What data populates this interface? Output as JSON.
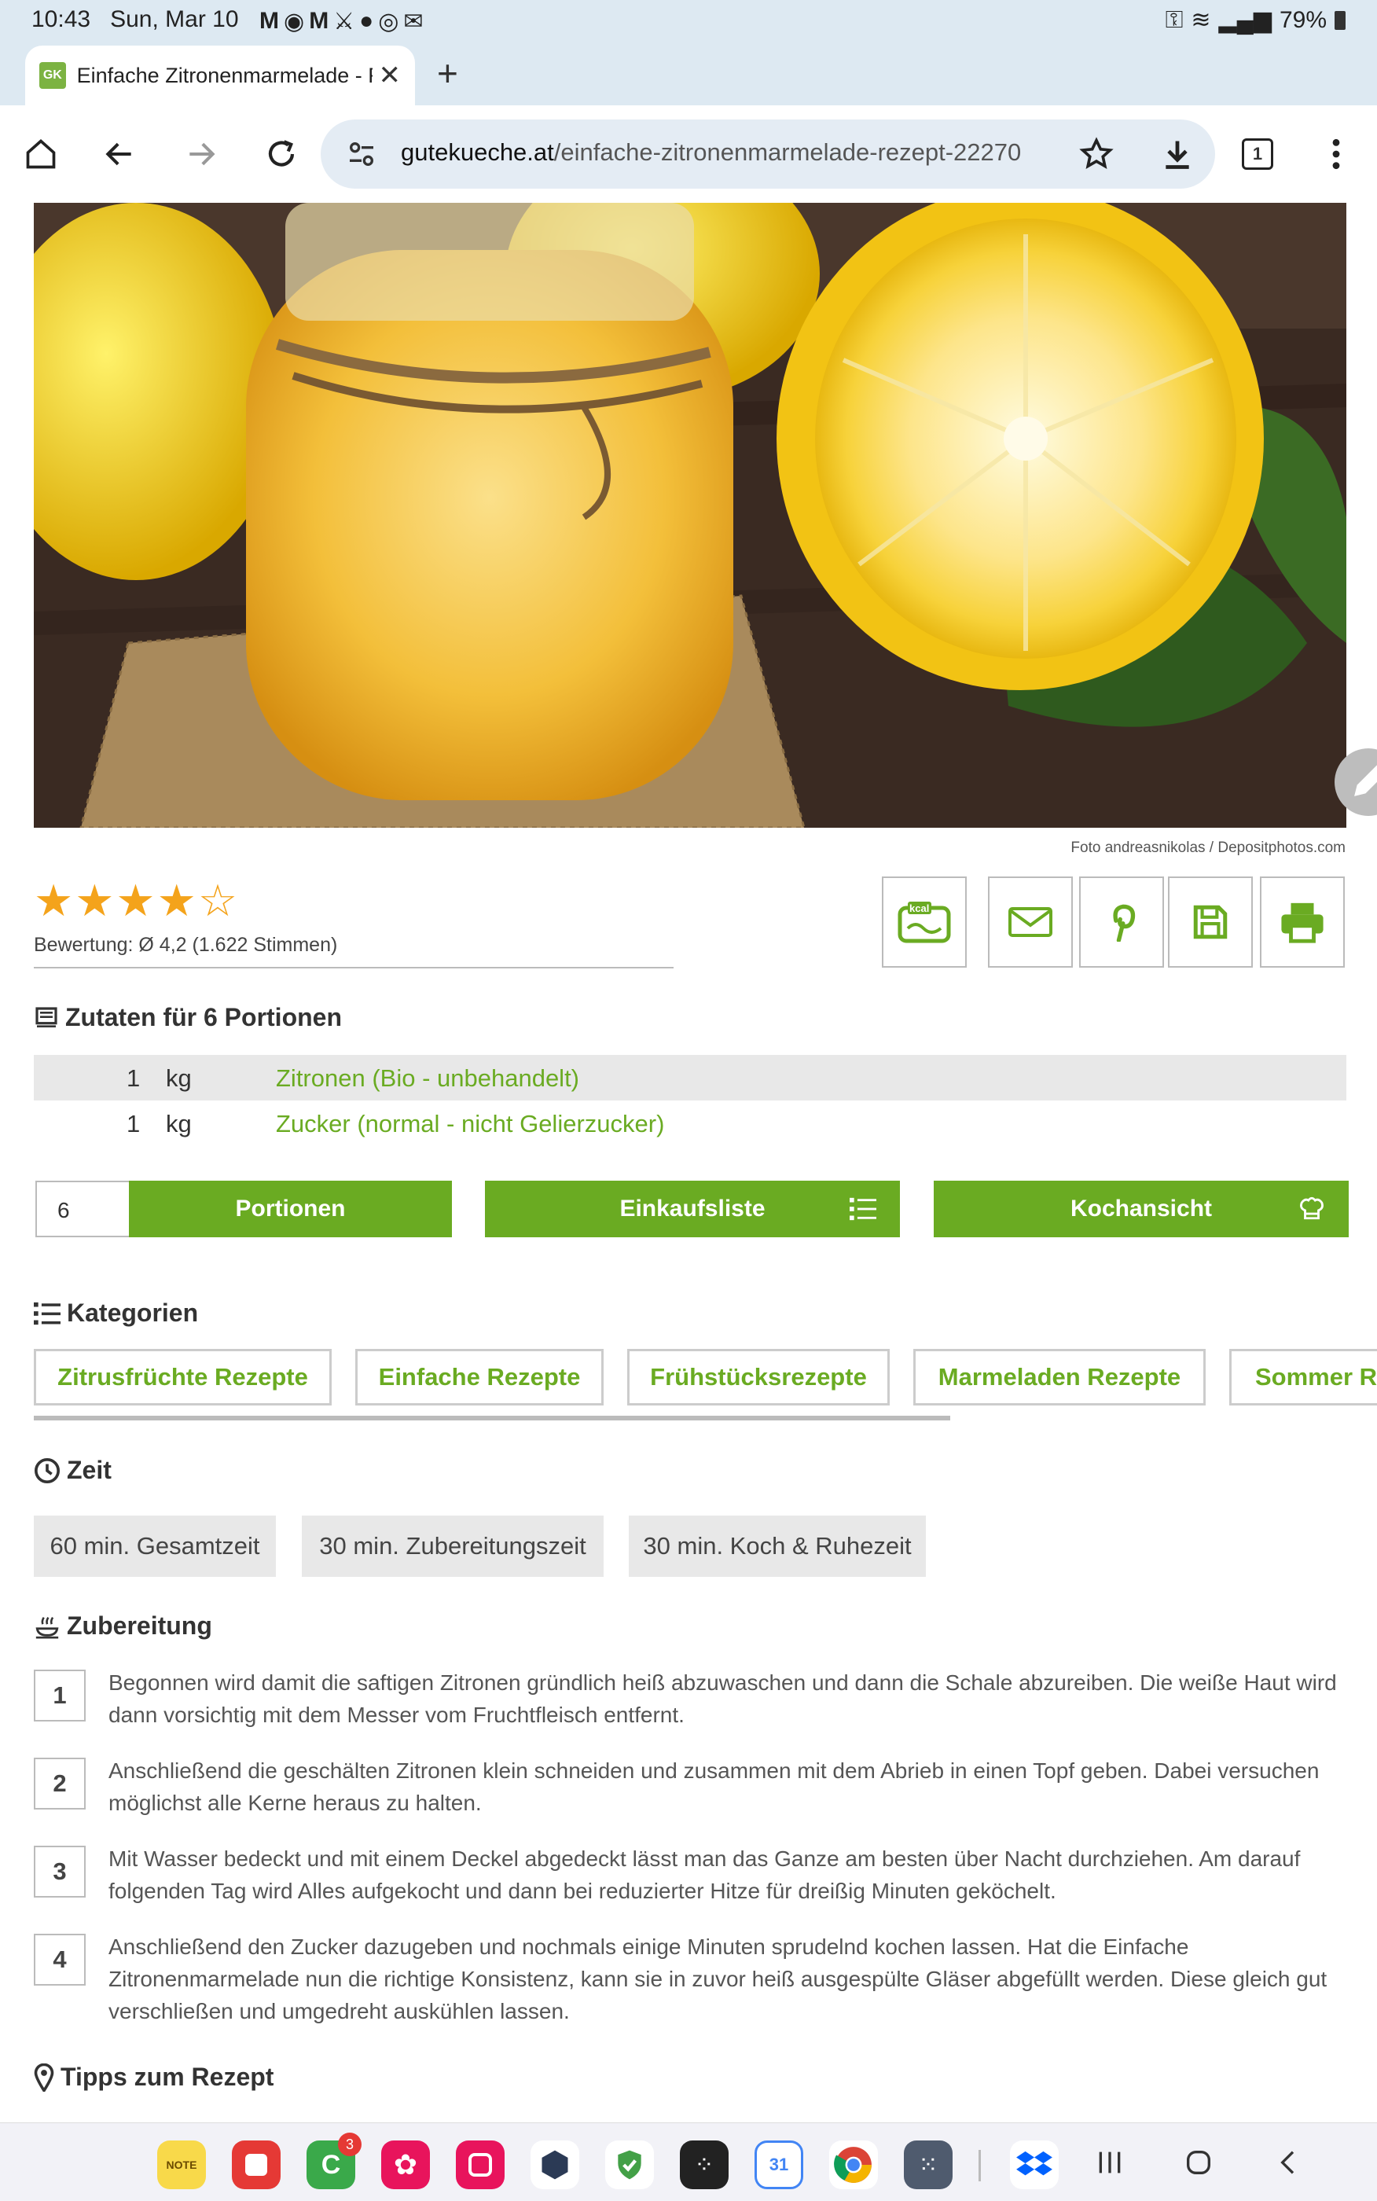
{
  "status_bar": {
    "time": "10:43",
    "date": "Sun, Mar 10",
    "battery": "79%"
  },
  "browser": {
    "tab_title": "Einfache Zitronenmarmelade - R",
    "url_domain": "gutekueche.at",
    "url_path": "/einfache-zitronenmarmelade-rezept-22270",
    "tab_count": "1"
  },
  "hero": {
    "credit": "Foto andreasnikolas / Depositphotos.com"
  },
  "rating": {
    "stars": 4,
    "max": 5,
    "text": "Bewertung: Ø 4,2 (1.622 Stimmen)"
  },
  "actions": [
    {
      "icon": "kcal-icon",
      "label": "kcal"
    },
    {
      "icon": "mail-icon"
    },
    {
      "icon": "pinterest-icon"
    },
    {
      "icon": "save-icon"
    },
    {
      "icon": "print-icon"
    }
  ],
  "ingredients": {
    "title": "Zutaten für 6 Portionen",
    "items": [
      {
        "amount": "1",
        "unit": "kg",
        "name": "Zitronen (Bio - unbehandelt)"
      },
      {
        "amount": "1",
        "unit": "kg",
        "name": "Zucker (normal - nicht Gelierzucker)"
      }
    ]
  },
  "portions": {
    "value": "6",
    "label": "Portionen"
  },
  "shopping_label": "Einkaufsliste",
  "cooking_view_label": "Kochansicht",
  "categories": {
    "title": "Kategorien",
    "items": [
      "Zitrusfrüchte Rezepte",
      "Einfache Rezepte",
      "Frühstücksrezepte",
      "Marmeladen Rezepte",
      "Sommer Re"
    ]
  },
  "time": {
    "title": "Zeit",
    "items": [
      "60 min. Gesamtzeit",
      "30 min. Zubereitungszeit",
      "30 min. Koch & Ruhezeit"
    ]
  },
  "preparation": {
    "title": "Zubereitung",
    "steps": [
      {
        "num": "1",
        "text": "Begonnen wird damit die saftigen Zitronen gründlich heiß abzuwaschen und dann die Schale abzureiben. Die weiße Haut wird dann vorsichtig mit dem Messer vom Fruchtfleisch entfernt."
      },
      {
        "num": "2",
        "text": "Anschließend die geschälten Zitronen klein schneiden und zusammen mit dem Abrieb in einen Topf geben. Dabei versuchen möglichst alle Kerne heraus zu halten."
      },
      {
        "num": "3",
        "text": "Mit Wasser bedeckt und mit einem Deckel abgedeckt lässt man das Ganze am besten über Nacht durchziehen. Am darauf folgenden Tag wird Alles aufgekocht und dann bei reduzierter Hitze für dreißig Minuten geköchelt."
      },
      {
        "num": "4",
        "text": "Anschließend den Zucker dazugeben und nochmals einige Minuten sprudelnd kochen lassen. Hat die Einfache Zitronenmarmelade nun die richtige Konsistenz, kann sie in zuvor heiß ausgespülte Gläser abgefüllt werden. Diese gleich gut verschließen und umgedreht auskühlen lassen."
      }
    ]
  },
  "tips": {
    "title": "Tipps zum Rezept"
  },
  "dock": {
    "phone_badge": "3",
    "calendar_day": "31"
  }
}
